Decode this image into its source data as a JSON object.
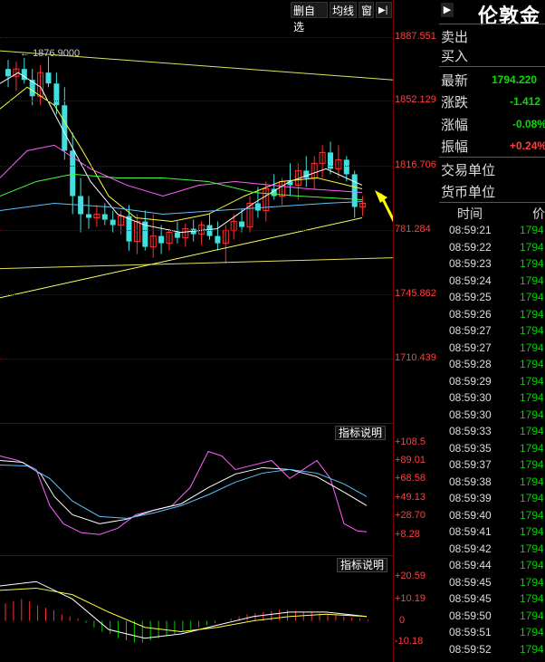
{
  "toolbar": {
    "delete_watchlist": "删自选",
    "lines": "均线",
    "window": "窗",
    "play_icon": "▶|"
  },
  "main_chart": {
    "price_labels": [
      "1887.551",
      "1852.129",
      "1816.706",
      "781.284",
      "1745.862",
      "1710.439"
    ],
    "high_marker": "1876.9000"
  },
  "indicator1": {
    "button": "指标说明",
    "labels": [
      "+108.5",
      "+89.01",
      "+68.58",
      "+49.13",
      "+28.70",
      "+8.28"
    ]
  },
  "indicator2": {
    "button": "指标说明",
    "labels": [
      "+20.59",
      "+10.19",
      "0",
      "-10.18"
    ]
  },
  "quote": {
    "title": "伦敦金",
    "sell": "卖出",
    "buy": "买入",
    "latest_label": "最新",
    "latest_value": "1794.220",
    "change_label": "涨跌",
    "change_value": "-1.412",
    "pct_label": "涨幅",
    "pct_value": "-0.08%",
    "amp_label": "振幅",
    "amp_value": "+0.24%",
    "unit_label": "交易单位",
    "currency_label": "货币单位",
    "time_header": "时间",
    "price_header": "价",
    "ticks": [
      {
        "time": "08:59:21",
        "price": "1794"
      },
      {
        "time": "08:59:22",
        "price": "1794"
      },
      {
        "time": "08:59:23",
        "price": "1794"
      },
      {
        "time": "08:59:24",
        "price": "1794"
      },
      {
        "time": "08:59:25",
        "price": "1794"
      },
      {
        "time": "08:59:26",
        "price": "1794"
      },
      {
        "time": "08:59:27",
        "price": "1794"
      },
      {
        "time": "08:59:27",
        "price": "1794"
      },
      {
        "time": "08:59:28",
        "price": "1794"
      },
      {
        "time": "08:59:29",
        "price": "1794"
      },
      {
        "time": "08:59:30",
        "price": "1794"
      },
      {
        "time": "08:59:30",
        "price": "1794"
      },
      {
        "time": "08:59:33",
        "price": "1794"
      },
      {
        "time": "08:59:35",
        "price": "1794"
      },
      {
        "time": "08:59:37",
        "price": "1794"
      },
      {
        "time": "08:59:38",
        "price": "1794"
      },
      {
        "time": "08:59:39",
        "price": "1794"
      },
      {
        "time": "08:59:40",
        "price": "1794"
      },
      {
        "time": "08:59:41",
        "price": "1794"
      },
      {
        "time": "08:59:42",
        "price": "1794"
      },
      {
        "time": "08:59:44",
        "price": "1794"
      },
      {
        "time": "08:59:45",
        "price": "1794"
      },
      {
        "time": "08:59:45",
        "price": "1794"
      },
      {
        "time": "08:59:50",
        "price": "1794"
      },
      {
        "time": "08:59:51",
        "price": "1794"
      },
      {
        "time": "08:59:52",
        "price": "1794"
      }
    ]
  },
  "colors": {
    "up_candle": "#ff3030",
    "down_candle": "#40e0e0",
    "grid": "#7a0000",
    "annotation_arrow": "#ffff00",
    "tick_price": "#00d000"
  }
}
